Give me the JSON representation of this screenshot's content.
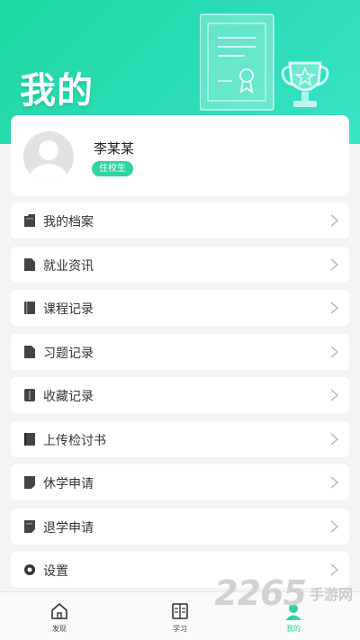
{
  "header": {
    "title": "我的"
  },
  "profile": {
    "name": "李某某",
    "badge": "住校生"
  },
  "menu": [
    {
      "label": "我的档案",
      "icon": "folder-icon"
    },
    {
      "label": "就业资讯",
      "icon": "document-icon"
    },
    {
      "label": "课程记录",
      "icon": "book-icon"
    },
    {
      "label": "习题记录",
      "icon": "document-icon"
    },
    {
      "label": "收藏记录",
      "icon": "bookmark-icon"
    },
    {
      "label": "上传检讨书",
      "icon": "document-icon"
    },
    {
      "label": "休学申请",
      "icon": "note-icon"
    },
    {
      "label": "退学申请",
      "icon": "note-icon"
    },
    {
      "label": "设置",
      "icon": "gear-icon"
    }
  ],
  "tabbar": {
    "items": [
      {
        "label": "发现",
        "icon": "home-icon",
        "active": false
      },
      {
        "label": "学习",
        "icon": "open-book-icon",
        "active": false
      },
      {
        "label": "我的",
        "icon": "user-icon",
        "active": true
      }
    ]
  },
  "watermark": {
    "number": "2265",
    "text": "手游网"
  },
  "colors": {
    "accent": "#2fd3a5",
    "header_gradient_start": "#1ed7a3",
    "header_gradient_end": "#38e4c7"
  }
}
